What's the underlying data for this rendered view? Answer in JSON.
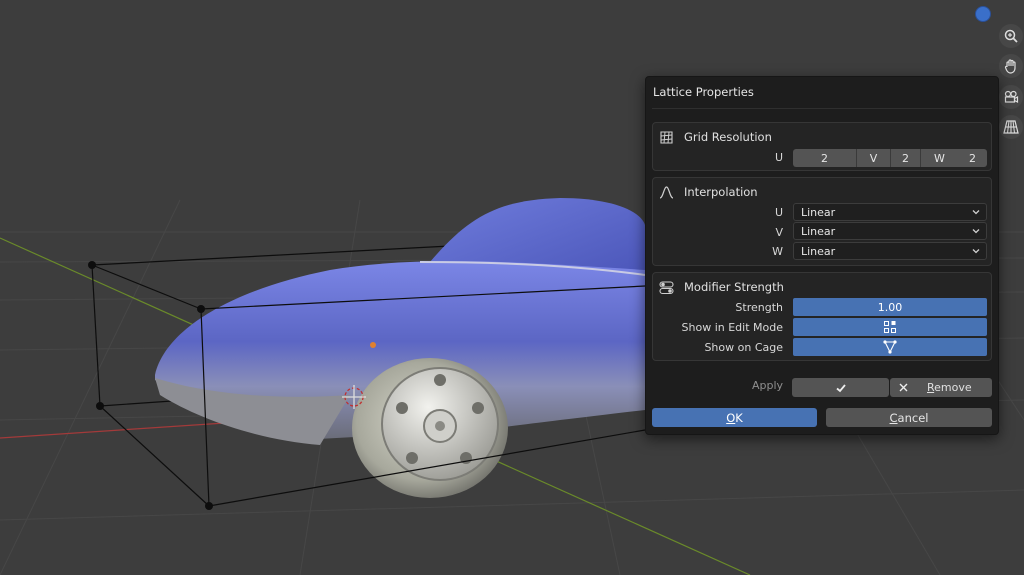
{
  "dialog": {
    "title": "Lattice Properties",
    "grid_resolution": {
      "header": "Grid Resolution",
      "label": "U",
      "u_value": "2",
      "v_label": "V",
      "v_value": "2",
      "w_label": "W",
      "w_value": "2"
    },
    "interpolation": {
      "header": "Interpolation",
      "rows": [
        {
          "label": "U",
          "value": "Linear"
        },
        {
          "label": "V",
          "value": "Linear"
        },
        {
          "label": "W",
          "value": "Linear"
        }
      ]
    },
    "modifier_strength": {
      "header": "Modifier Strength",
      "strength_label": "Strength",
      "strength_value": "1.00",
      "edit_mode_label": "Show in Edit Mode",
      "cage_label": "Show on Cage"
    },
    "apply": {
      "label": "Apply",
      "remove_label": "Remove"
    },
    "ok_label": "OK",
    "cancel_label": "Cancel"
  },
  "colors": {
    "accent": "#4772b3",
    "viewport_bg": "#3d3d3d",
    "car_body": "#6b78d8",
    "grid_x_axis": "#a33a3a",
    "grid_y_axis": "#6a8a2a"
  },
  "icons": [
    "zoom-icon",
    "hand-icon",
    "camera-icon",
    "perspective-grid-icon",
    "lattice-icon",
    "curve-icon",
    "toggle-icon",
    "checkmark-icon",
    "x-icon",
    "edit-mode-icon",
    "cage-icon",
    "chevron-down-icon"
  ]
}
